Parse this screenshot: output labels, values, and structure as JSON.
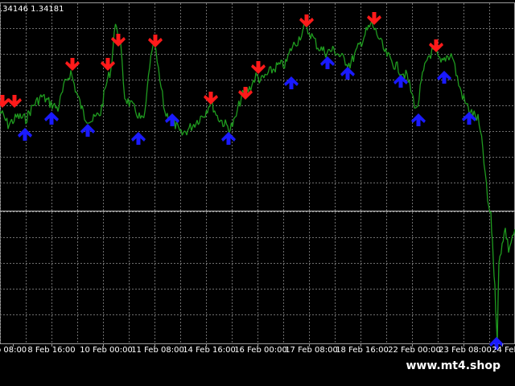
{
  "chart": {
    "ohlc_readout": ".34146 1.34181",
    "time_axis_labels": [
      "b 08:00",
      "8 Feb 16:00",
      "10 Feb 00:00",
      "11 Feb 08:00",
      "14 Feb 16:00",
      "16 Feb 00:00",
      "17 Feb 08:00",
      "18 Feb 16:00",
      "22 Feb 00:00",
      "23 Feb 08:00",
      "24 Feb"
    ],
    "colors": {
      "background": "#000000",
      "grid": "#6e6e6e",
      "price_line": "#1f9b1f",
      "sell_arrow": "#ff1a1a",
      "buy_arrow": "#1a1aff",
      "text": "#ffffff"
    },
    "signals": {
      "sell_arrow_icon": "arrow-down-icon",
      "buy_arrow_icon": "arrow-up-icon",
      "sell_count": 15,
      "buy_count": 14
    }
  },
  "watermark": {
    "text": "www.mt4.shop"
  }
}
